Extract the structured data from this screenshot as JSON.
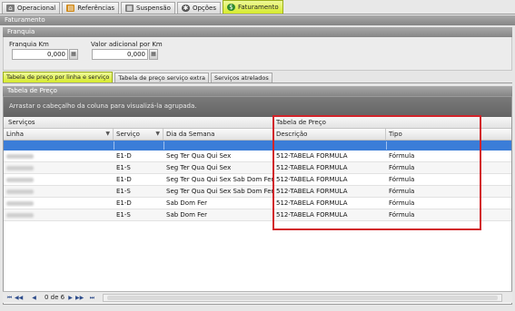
{
  "top_tabs": [
    {
      "label": "Operacional",
      "icon": "home-icon",
      "color": "#7a7a7a"
    },
    {
      "label": "Referências",
      "icon": "book-icon",
      "color": "#d08a1a"
    },
    {
      "label": "Suspensão",
      "icon": "table-icon",
      "color": "#777777"
    },
    {
      "label": "Opções",
      "icon": "gear-icon",
      "color": "#555555"
    },
    {
      "label": "Faturamento",
      "icon": "dollar-icon",
      "color": "#2f8a2f"
    }
  ],
  "faturamento_header": "Faturamento",
  "franquia": {
    "header": "Franquia",
    "km_label": "Franquia Km",
    "km_value": "0,000",
    "adicional_label": "Valor adicional por Km",
    "adicional_value": "0,000"
  },
  "sub_tabs": [
    "Tabela de preço por linha e serviço",
    "Tabela de preço serviço extra",
    "Serviços atrelados"
  ],
  "tabela_header": "Tabela de Preço",
  "group_hint": "Arrastar o cabeçalho da coluna para visualizá-la agrupada.",
  "bands": {
    "servicos": "Serviços",
    "tabela": "Tabela de Preço"
  },
  "columns": {
    "linha": "Linha",
    "servico": "Serviço",
    "dia": "Dia da Semana",
    "descricao": "Descrição",
    "tipo": "Tipo"
  },
  "rows": [
    {
      "servico": "E1-D",
      "dia": "Seg Ter Qua Qui Sex",
      "descricao": "512-TABELA FORMULA",
      "tipo": "Fórmula"
    },
    {
      "servico": "E1-S",
      "dia": "Seg Ter Qua Qui Sex",
      "descricao": "512-TABELA FORMULA",
      "tipo": "Fórmula"
    },
    {
      "servico": "E1-D",
      "dia": "Seg Ter Qua Qui Sex Sab Dom Fer",
      "descricao": "512-TABELA FORMULA",
      "tipo": "Fórmula"
    },
    {
      "servico": "E1-S",
      "dia": "Seg Ter Qua Qui Sex Sab Dom Fer",
      "descricao": "512-TABELA FORMULA",
      "tipo": "Fórmula"
    },
    {
      "servico": "E1-D",
      "dia": "Sab Dom Fer",
      "descricao": "512-TABELA FORMULA",
      "tipo": "Fórmula"
    },
    {
      "servico": "E1-S",
      "dia": "Sab Dom Fer",
      "descricao": "512-TABELA FORMULA",
      "tipo": "Fórmula"
    }
  ],
  "pager": {
    "text": "0 de 6"
  },
  "highlight_color": "#d2232a"
}
